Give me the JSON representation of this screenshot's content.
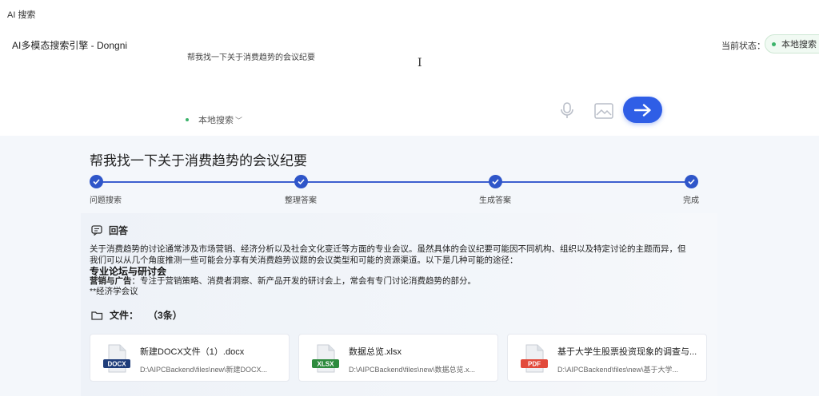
{
  "window": {
    "title": "AI 搜索"
  },
  "header": {
    "engine_name": "AI多模态搜索引擎 - Dongni",
    "status_label": "当前状态：",
    "status_value": "本地搜索"
  },
  "search": {
    "query": "帮我找一下关于消费趋势的会议纪要",
    "mode": "本地搜索",
    "mode_chevron": "﹀"
  },
  "result": {
    "title": "帮我找一下关于消费趋势的会议纪要",
    "steps": [
      {
        "label": "问题搜索",
        "done": true
      },
      {
        "label": "整理答案",
        "done": true
      },
      {
        "label": "生成答案",
        "done": true
      },
      {
        "label": "完成",
        "done": true
      }
    ],
    "answer": {
      "header": "回答",
      "intro_line1": "关于消费趋势的讨论通常涉及市场营销、经济分析以及社会文化变迁等方面的专业会议。虽然具体的会议纪要可能因不同机构、组织以及特定讨论的主题而异，但",
      "intro_line2": "我们可以从几个角度推测一些可能会分享有关消费趋势议题的会议类型和可能的资源渠道。以下是几种可能的途径：",
      "subheading": "专业论坛与研讨会",
      "item_label": "营销与广告",
      "item_text": "：专注于营销策略、消费者洞察、新产品开发的研讨会上，常会有专门讨论消费趋势的部分。",
      "item2": "**经济学会议"
    },
    "files": {
      "header": "文件：",
      "count": "（3条）",
      "items": [
        {
          "name": "新建DOCX文件（1）.docx",
          "path": "D:\\AIPCBackend\\files\\new\\新建DOCX...",
          "type": "DOCX",
          "color": "#1f3d7a"
        },
        {
          "name": "数据总览.xlsx",
          "path": "D:\\AIPCBackend\\files\\new\\数据总览.x...",
          "type": "XLSX",
          "color": "#2e8b3e"
        },
        {
          "name": "基于大学生股票投资现象的调查与...",
          "path": "D:\\AIPCBackend\\files\\new\\基于大学...",
          "type": "PDF",
          "color": "#e24a3b"
        }
      ]
    }
  },
  "colors": {
    "accent": "#2f5ee6",
    "status_green": "#3bb36a"
  }
}
